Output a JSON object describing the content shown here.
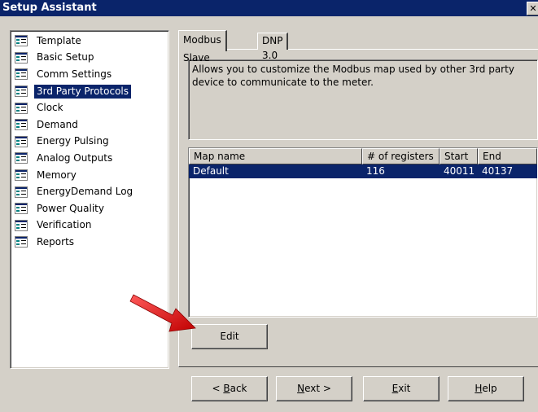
{
  "window": {
    "title": "Setup Assistant",
    "close_glyph": "✕"
  },
  "tree": {
    "items": [
      {
        "label": "Template"
      },
      {
        "label": "Basic Setup"
      },
      {
        "label": "Comm Settings"
      },
      {
        "label": "3rd Party Protocols",
        "selected": true
      },
      {
        "label": "Clock"
      },
      {
        "label": "Demand"
      },
      {
        "label": "Energy Pulsing"
      },
      {
        "label": "Analog Outputs"
      },
      {
        "label": "Memory"
      },
      {
        "label": "EnergyDemand Log"
      },
      {
        "label": "Power Quality"
      },
      {
        "label": "Verification"
      },
      {
        "label": "Reports"
      }
    ]
  },
  "tabs": [
    {
      "label": "Modbus Slave",
      "active": true
    },
    {
      "label": "DNP 3.0",
      "active": false
    }
  ],
  "description": "Allows you to customize the Modbus map used by other 3rd party device to communicate to the meter.",
  "maps": {
    "columns": [
      "Map name",
      "# of registers",
      "Start",
      "End"
    ],
    "rows": [
      {
        "name": "Default",
        "registers": "116",
        "start": "40011",
        "end": "40137"
      }
    ]
  },
  "buttons": {
    "edit": "Edit",
    "back_prefix": "< ",
    "back_key": "B",
    "back_rest": "ack",
    "next_key": "N",
    "next_rest": "ext >",
    "exit_key": "E",
    "exit_rest": "xit",
    "help_key": "H",
    "help_rest": "elp"
  },
  "colors": {
    "selection": "#0a246a",
    "face": "#d4d0c8",
    "arrow": "#e02020"
  }
}
